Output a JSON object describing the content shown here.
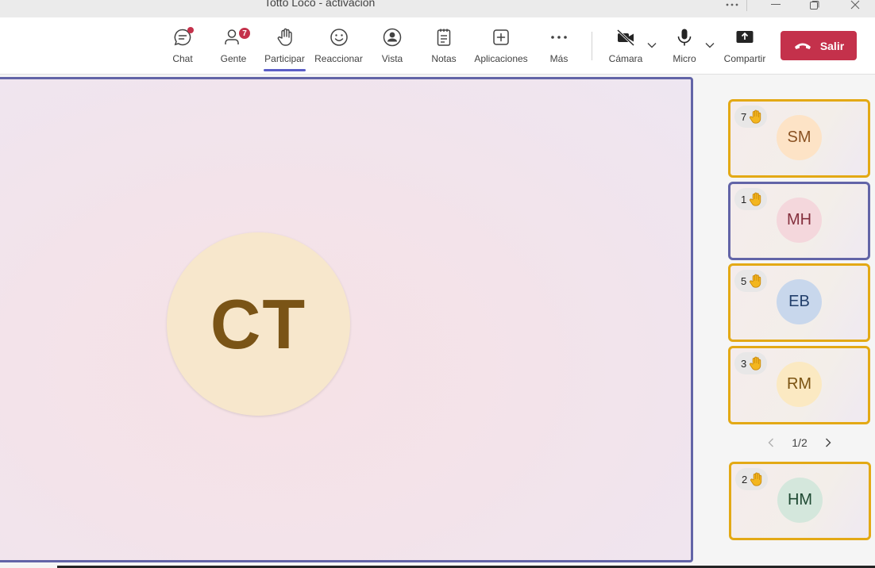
{
  "window": {
    "title": "Totto Loco - activación",
    "icons": [
      "more-icon",
      "minimize-icon",
      "restore-icon",
      "close-icon"
    ]
  },
  "toolbar": {
    "chat": "Chat",
    "people": "Gente",
    "people_badge": "7",
    "participate": "Participar",
    "react": "Reaccionar",
    "view": "Vista",
    "notes": "Notas",
    "apps": "Aplicaciones",
    "more": "Más",
    "camera": "Cámara",
    "mic": "Micro",
    "share": "Compartir",
    "leave": "Salir"
  },
  "colors": {
    "accent": "#5b5fc7",
    "speaking_border": "#6264a7",
    "hand_raised_border": "#e3a915",
    "leave": "#c4314b"
  },
  "main": {
    "initials": "CT"
  },
  "participants": [
    {
      "initials": "SM",
      "hand_count": "7",
      "speaking": false,
      "avatar_bg": "#fde3c6",
      "avatar_fg": "#8a5222"
    },
    {
      "initials": "MH",
      "hand_count": "1",
      "speaking": true,
      "avatar_bg": "#f4d7dc",
      "avatar_fg": "#842f3d"
    },
    {
      "initials": "EB",
      "hand_count": "5",
      "speaking": false,
      "avatar_bg": "#c8d7ec",
      "avatar_fg": "#223f6b"
    },
    {
      "initials": "RM",
      "hand_count": "3",
      "speaking": false,
      "avatar_bg": "#fbe9c2",
      "avatar_fg": "#7b5412"
    },
    {
      "initials": "HM",
      "hand_count": "2",
      "speaking": false,
      "avatar_bg": "#d4e7dc",
      "avatar_fg": "#1f4a33"
    }
  ],
  "pager": {
    "label": "1/2"
  }
}
